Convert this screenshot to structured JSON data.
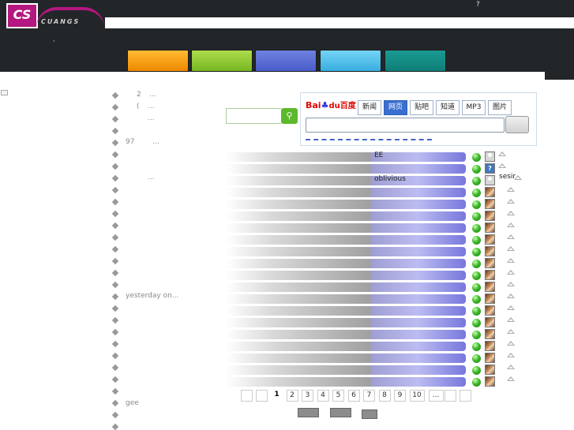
{
  "header": {
    "logo_mark": "CS",
    "logo_word": "CUANGS",
    "help_label": "?",
    "dot_label": ","
  },
  "nav_tabs": [
    {
      "color": "#ee8800"
    },
    {
      "color": "#77b722"
    },
    {
      "color": "#4a5cc9"
    },
    {
      "color": "#38aee0"
    },
    {
      "color": "#0e7f78"
    }
  ],
  "left_list": {
    "item_2": {
      "prefix": "2",
      "ellipsis": "..."
    },
    "item_paren": {
      "prefix": "(",
      "ellipsis": "..."
    },
    "item_plain": {
      "ellipsis": "..."
    },
    "item_97": {
      "prefix": "97",
      "ellipsis": "..."
    },
    "item_after_97": {
      "ellipsis": "..."
    },
    "item_yesterday": {
      "text": "yesterday on..."
    },
    "item_gee": {
      "text": "gee"
    }
  },
  "search": {
    "input_value": "",
    "button_icon": "search-icon"
  },
  "baidu": {
    "logo_bai": "Bai",
    "logo_paw": "♣",
    "logo_du": "du百度",
    "tabs": [
      {
        "label": "新闻"
      },
      {
        "label": "网页"
      },
      {
        "label": "贴吧"
      },
      {
        "label": "知道"
      },
      {
        "label": "MP3"
      },
      {
        "label": "图片"
      }
    ],
    "active_tab": 1,
    "query": ""
  },
  "list_rows": [
    {
      "text": "EE",
      "avatar": "silhouette"
    },
    {
      "text": "",
      "avatar": "question"
    },
    {
      "text": "oblivious",
      "avatar": "silhouette",
      "side_label": "sesir"
    },
    {
      "text": "",
      "avatar": "photo"
    },
    {
      "text": "",
      "avatar": "photo"
    },
    {
      "text": "",
      "avatar": "photo"
    },
    {
      "text": "",
      "avatar": "photo"
    },
    {
      "text": "",
      "avatar": "photo"
    },
    {
      "text": "",
      "avatar": "photo"
    },
    {
      "text": "",
      "avatar": "photo"
    },
    {
      "text": "",
      "avatar": "photo"
    },
    {
      "text": "",
      "avatar": "photo"
    },
    {
      "text": "",
      "avatar": "photo"
    },
    {
      "text": "",
      "avatar": "photo"
    },
    {
      "text": "",
      "avatar": "photo"
    },
    {
      "text": "",
      "avatar": "photo"
    },
    {
      "text": "",
      "avatar": "photo"
    },
    {
      "text": "",
      "avatar": "photo"
    },
    {
      "text": "",
      "avatar": "photo"
    },
    {
      "text": "",
      "avatar": "photo"
    }
  ],
  "pagination": {
    "pages": [
      "1",
      "2",
      "3",
      "4",
      "5",
      "6",
      "7",
      "8",
      "9",
      "10",
      "..."
    ],
    "current": "1"
  }
}
